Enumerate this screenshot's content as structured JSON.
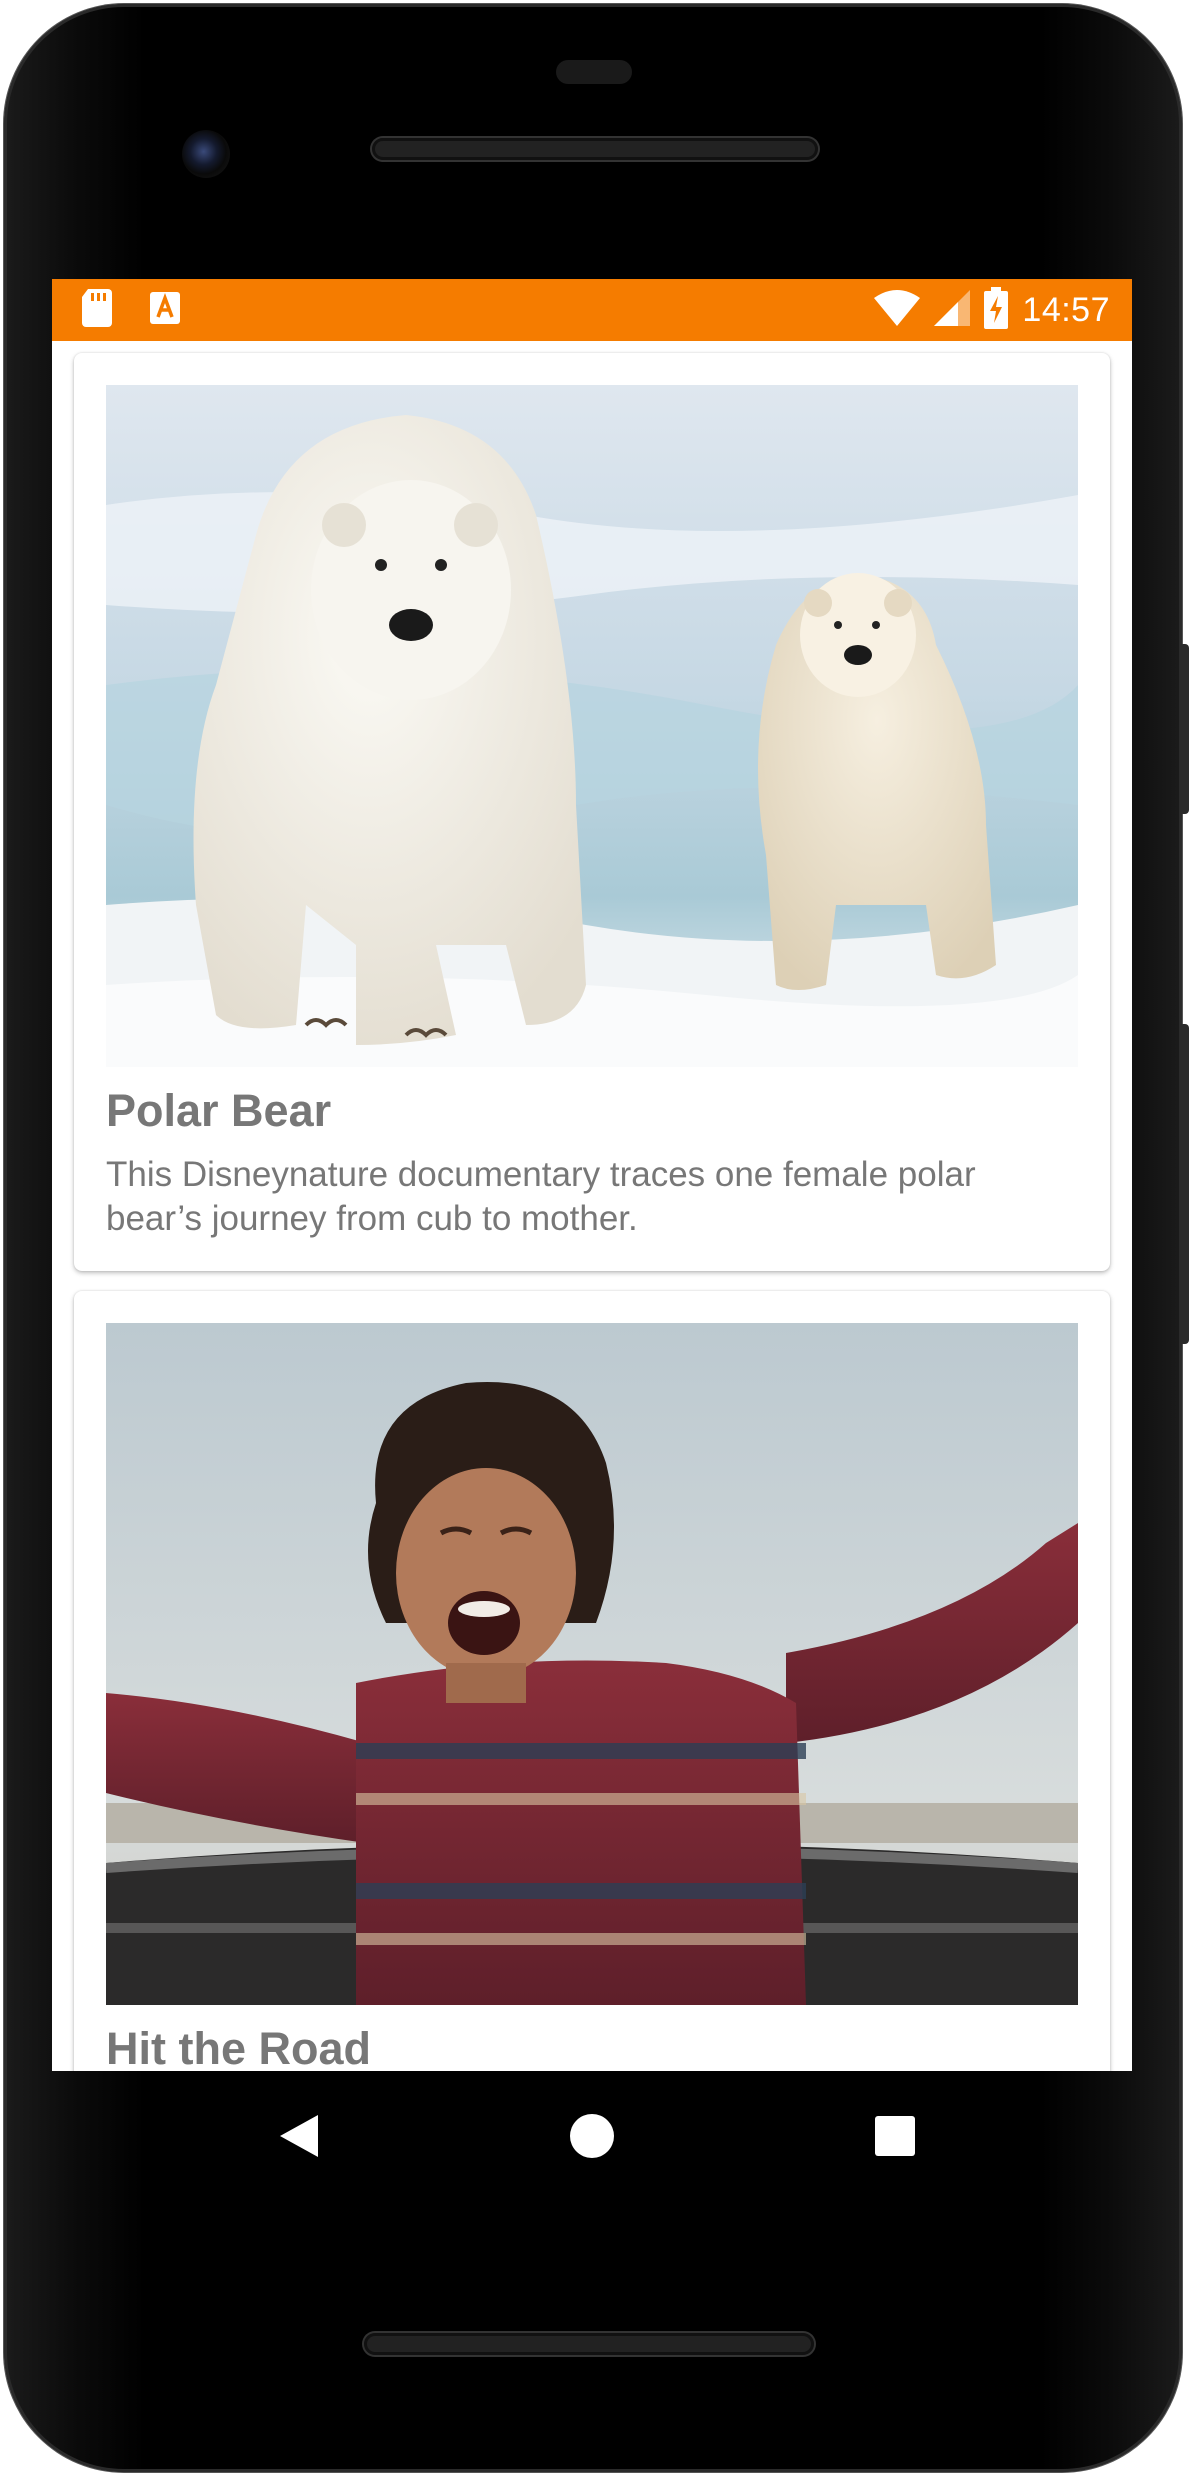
{
  "status_bar": {
    "time": "14:57",
    "background": "#f57c00",
    "left_icons": [
      "sd-card-icon",
      "text-a-icon"
    ],
    "right_icons": [
      "wifi-icon",
      "cell-signal-icon",
      "battery-charging-icon"
    ]
  },
  "cards": [
    {
      "title": "Polar Bear",
      "description": "This Disneynature documentary traces one female polar bear’s journey from cub to mother.",
      "image": "polar-bear-image"
    },
    {
      "title": "Hit the Road",
      "description": "",
      "image": "hit-the-road-image"
    }
  ],
  "nav_bar": {
    "buttons": [
      "back-icon",
      "home-icon",
      "recents-icon"
    ]
  }
}
